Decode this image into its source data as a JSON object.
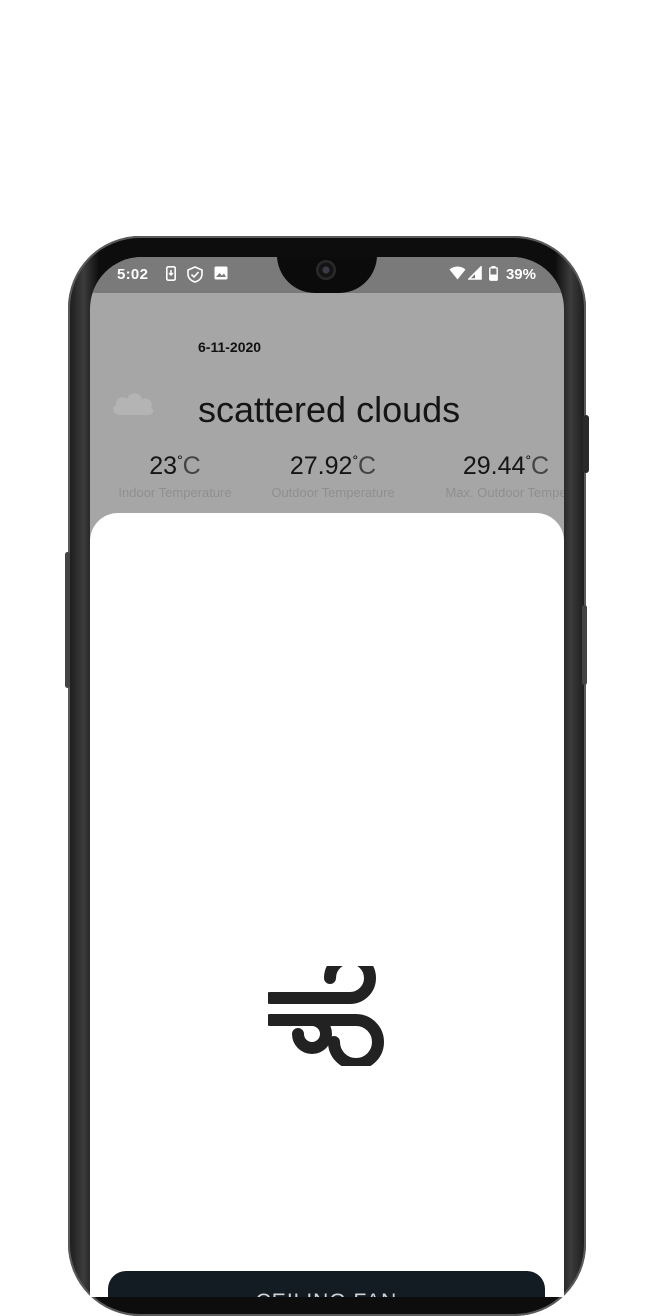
{
  "status_bar": {
    "time": "5:02",
    "battery": "39%"
  },
  "weather": {
    "date": "6-11-2020",
    "description": "scattered clouds",
    "temperatures": [
      {
        "value": "23",
        "unit": "C",
        "label": "Indoor Temperature"
      },
      {
        "value": "27.92",
        "unit": "C",
        "label": "Outdoor Temperature"
      },
      {
        "value": "29.44",
        "unit": "C",
        "label": "Max. Outdoor Tempe"
      }
    ]
  },
  "device": {
    "icon": "wind-icon",
    "name": "CEILING FAN"
  },
  "icons": [
    "cloud-icon",
    "wind-icon",
    "download-icon",
    "shield-icon",
    "image-icon",
    "wifi-icon",
    "signal-icon",
    "battery-icon"
  ]
}
